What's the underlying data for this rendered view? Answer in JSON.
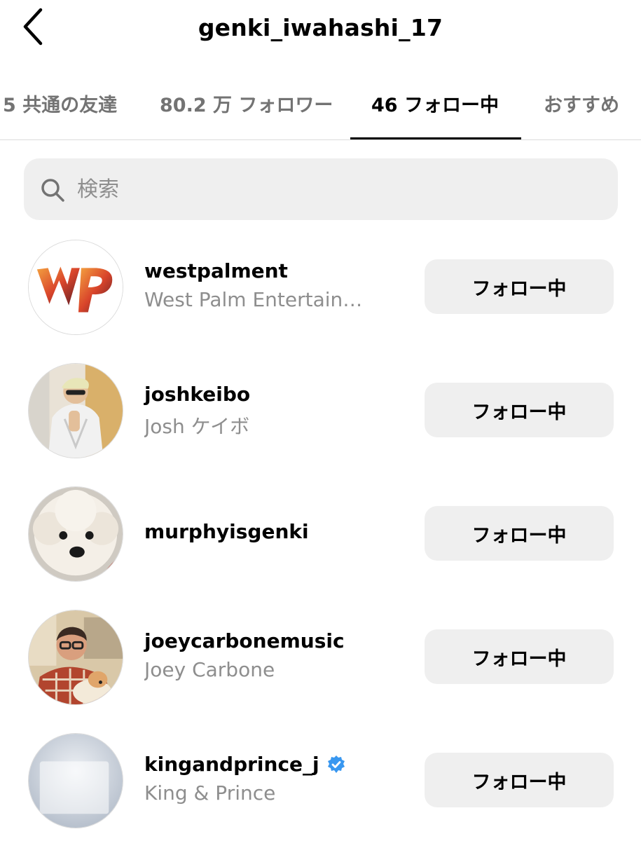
{
  "header": {
    "title": "genki_iwahashi_17",
    "back_icon": "chevron-left-icon"
  },
  "tabs": [
    {
      "label": "5 共通の友達",
      "active": false
    },
    {
      "label": "80.2 万 フォロワー",
      "active": false
    },
    {
      "label": "46 フォロー中",
      "active": true
    },
    {
      "label": "おすすめ",
      "active": false
    }
  ],
  "search": {
    "placeholder": "検索",
    "value": "",
    "icon": "search-icon"
  },
  "following": [
    {
      "username": "westpalment",
      "full_name": "West Palm Entertainm...",
      "button_label": "フォロー中",
      "verified": false
    },
    {
      "username": "joshkeibo",
      "full_name": "Josh ケイボ",
      "button_label": "フォロー中",
      "verified": false
    },
    {
      "username": "murphyisgenki",
      "full_name": "",
      "button_label": "フォロー中",
      "verified": false
    },
    {
      "username": "joeycarbonemusic",
      "full_name": "Joey Carbone",
      "button_label": "フォロー中",
      "verified": false
    },
    {
      "username": "kingandprince_j",
      "full_name": "King & Prince",
      "button_label": "フォロー中",
      "verified": true
    }
  ],
  "colors": {
    "verified_badge": "#3897f0",
    "secondary_text": "#8e8e8e",
    "button_bg": "#efefef"
  }
}
